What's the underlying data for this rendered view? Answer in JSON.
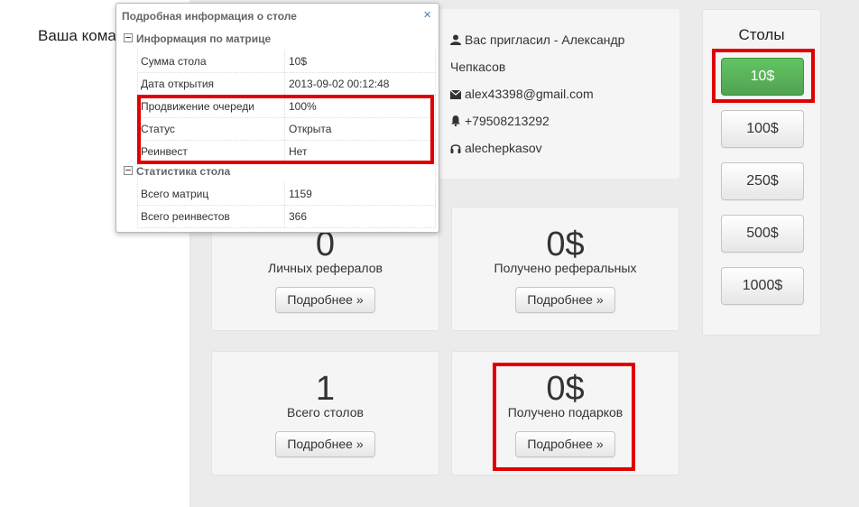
{
  "left": {
    "title": "Ваша кома"
  },
  "contact": {
    "invited_by": "Вас пригласил - Александр",
    "invited_by_cont": "Чепкасов",
    "email": "alex43398@gmail.com",
    "phone": "+79508213292",
    "skype": "alechepkasov"
  },
  "stats": [
    {
      "value": "0",
      "label": "Личных рефералов",
      "button": "Подробнее »"
    },
    {
      "value": "0$",
      "label": "Получено реферальных",
      "button": "Подробнее »"
    },
    {
      "value": "1",
      "label": "Всего столов",
      "button": "Подробнее »"
    },
    {
      "value": "0$",
      "label": "Получено подарков",
      "button": "Подробнее »"
    }
  ],
  "tables": {
    "title": "Столы",
    "buttons": [
      "10$",
      "100$",
      "250$",
      "500$",
      "1000$"
    ],
    "active": "10$"
  },
  "popup": {
    "title": "Подробная информация о столе",
    "close": "×",
    "matrix_section": "Информация по матрице",
    "matrix_rows": [
      {
        "key": "Сумма стола",
        "value": "10$"
      },
      {
        "key": "Дата открытия",
        "value": "2013-09-02 00:12:48"
      },
      {
        "key": "Продвижение очереди",
        "value": "100%"
      },
      {
        "key": "Статус",
        "value": "Открыта"
      },
      {
        "key": "Реинвест",
        "value": "Нет"
      }
    ],
    "stats_section": "Статистика стола",
    "stats_rows": [
      {
        "key": "Всего матриц",
        "value": "1159"
      },
      {
        "key": "Всего реинвестов",
        "value": "366"
      }
    ]
  },
  "colors": {
    "accent_green": "#5cb85c",
    "highlight_red": "#e00000",
    "link_blue": "#4a7fb8"
  },
  "icons": [
    "user-icon",
    "envelope-icon",
    "bell-icon",
    "headphones-icon",
    "close-icon",
    "collapse-icon"
  ]
}
